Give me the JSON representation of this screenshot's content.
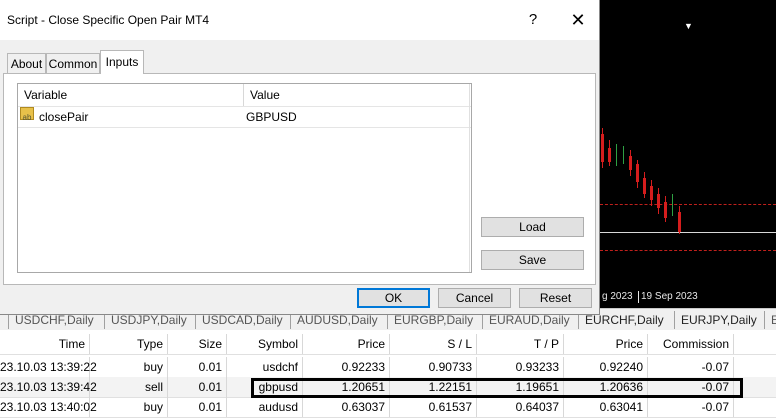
{
  "dialog": {
    "title": "Script - Close Specific Open Pair MT4",
    "help_glyph": "?",
    "close_glyph": "✕",
    "tabs": [
      {
        "label": "About"
      },
      {
        "label": "Common"
      },
      {
        "label": "Inputs"
      }
    ],
    "active_tab": "Inputs",
    "grid": {
      "header_variable": "Variable",
      "header_value": "Value",
      "rows": [
        {
          "icon_text": "ab",
          "variable": "closePair",
          "value": "GBPUSD"
        }
      ]
    },
    "buttons": {
      "load": "Load",
      "save": "Save",
      "ok": "OK",
      "cancel": "Cancel",
      "reset": "Reset"
    }
  },
  "chart": {
    "marker_glyph": "▼",
    "date_label_1": "g 2023",
    "date_label_2": "19 Sep 2023",
    "colors": {
      "background": "#000000",
      "bear_candle": "#d51d1d",
      "level_line": "#c0201c"
    }
  },
  "symbol_tabs": [
    "USDCHF,Daily",
    "USDJPY,Daily",
    "USDCAD,Daily",
    "AUDUSD,Daily",
    "EURGBP,Daily",
    "EURAUD,Daily",
    "EURCHF,Daily",
    "EURJPY,Daily",
    "E"
  ],
  "trade": {
    "columns": [
      "Time",
      "Type",
      "Size",
      "Symbol",
      "Price",
      "S / L",
      "T / P",
      "Price",
      "Commission"
    ],
    "rows": [
      {
        "time": "23.10.03 13:39:22",
        "type": "buy",
        "size": "0.01",
        "symbol": "usdchf",
        "price": "0.92233",
        "sl": "0.90733",
        "tp": "0.93233",
        "price2": "0.92240",
        "commission": "-0.07"
      },
      {
        "time": "23.10.03 13:39:42",
        "type": "sell",
        "size": "0.01",
        "symbol": "gbpusd",
        "price": "1.20651",
        "sl": "1.22151",
        "tp": "1.19651",
        "price2": "1.20636",
        "commission": "-0.07"
      },
      {
        "time": "23.10.03 13:40:02",
        "type": "buy",
        "size": "0.01",
        "symbol": "audusd",
        "price": "0.63037",
        "sl": "0.61537",
        "tp": "0.64037",
        "price2": "0.63041",
        "commission": "-0.07"
      }
    ]
  }
}
